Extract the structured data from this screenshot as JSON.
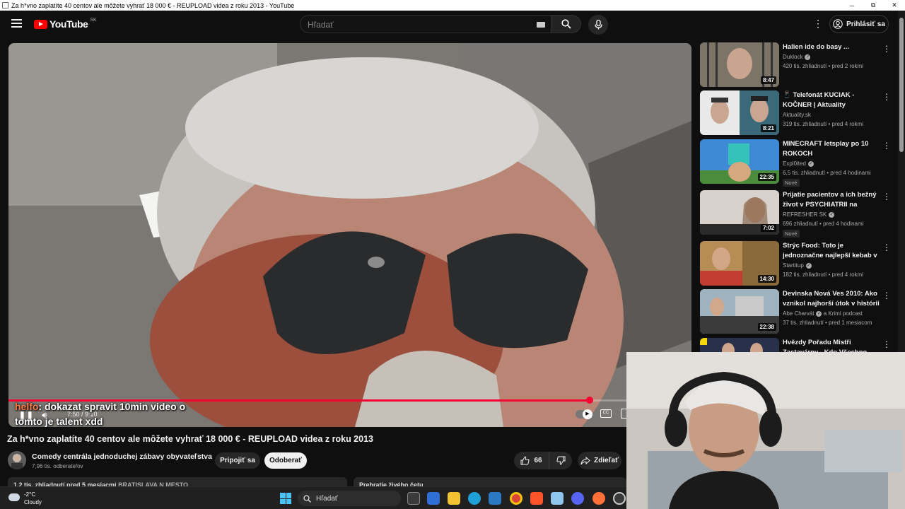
{
  "window": {
    "title": "Za h*vno zaplatíte 40 centov ale môžete vyhrať 18 000 € - REUPLOAD videa z roku 2013 - YouTube",
    "minimize": "─",
    "maximize": "⧉",
    "close": "✕"
  },
  "header": {
    "logo_text": "YouTube",
    "country_code": "SK",
    "search_placeholder": "Hľadať",
    "signin_label": "Prihlásiť sa"
  },
  "player": {
    "current_time": "7:50",
    "duration": "9:10",
    "time_display": "7:50 / 9:10",
    "progress": 0.94,
    "chat_user": "helfo",
    "chat_message": ": dokazat spravit 10min video o tomto je talent xdd"
  },
  "video": {
    "title": "Za h*vno zaplatíte 40 centov ale môžete vyhrať 18 000 € - REUPLOAD videa z roku 2013",
    "channel": "Comedy centrála jednoduchej zábavy obyvateľstva",
    "subscribers": "7,96 tis. odberateľov",
    "join_label": "Pripojiť sa",
    "subscribe_label": "Odoberať",
    "likes": "66",
    "share_label": "Zdieľať",
    "description_stats": "1,2 tis. zhliadnutí pred 5 mesiacmi",
    "description_tag": "BRATISLAVA N MESTO",
    "live_chat_label": "Prehratie živého četu"
  },
  "sidebar": {
    "items": [
      {
        "title": "Halien ide do basy ...",
        "channel": "Duklock",
        "verified": true,
        "meta": "420 tis. zhliadnutí • pred 2 rokmi",
        "duration": "8:47",
        "badge": "",
        "thumb_color": "#7d7468"
      },
      {
        "title": "📱 Telefonát  KUCIAK - KOČNER | Aktuality",
        "channel": "Aktuality.sk",
        "verified": false,
        "meta": "319 tis. zhliadnutí • pred 4 rokmi",
        "duration": "8:21",
        "badge": "",
        "thumb_color": "#e9e9e9"
      },
      {
        "title": "MINECRAFT letsplay po 10 ROKOCH",
        "channel": "Expl0ited",
        "verified": true,
        "meta": "6,5 tis. zhliadnutí • pred 4 hodinami",
        "duration": "22:35",
        "badge": "Nové",
        "thumb_color": "#3f8ad6"
      },
      {
        "title": "Prijatie pacientov a ich bežný život v PSYCHIATRII na Predn...",
        "channel": "REFRESHER SK",
        "verified": true,
        "meta": "696 zhliadnutí • pred 4 hodinami",
        "duration": "7:02",
        "badge": "Nové",
        "thumb_color": "#d9d1cb"
      },
      {
        "title": "Strýc Food: Toto je jednoznačne najlepší kebab v Bratislave 👌",
        "channel": "Startitup",
        "verified": true,
        "meta": "182 tis. zhliadnutí • pred 4 rokmi",
        "duration": "14:30",
        "badge": "",
        "thumb_color": "#b88c55"
      },
      {
        "title": "Devinska Nová Ves 2010: Ako vznikol najhorší útok v histórii ...",
        "channel": "Abe Charvát",
        "verified": true,
        "channel_suffix": "a Krimi podcast",
        "meta": "37 tis. zhliadnutí • pred 1 mesiacom",
        "duration": "22:38",
        "badge": "",
        "thumb_color": "#9fb2bf"
      },
      {
        "title": "Hvězdy Pořadu Mistři Zastavárny - Kdo Všechno...",
        "channel": "",
        "verified": false,
        "meta": "",
        "duration": "",
        "badge": "",
        "thumb_color": "#27324a"
      }
    ]
  },
  "taskbar": {
    "temperature": "-2°C",
    "weather": "Cloudy",
    "search_label": "Hľadať"
  },
  "colors": {
    "accent": "#ff0033",
    "background": "#0f0f0f",
    "chat_user": "#ff7a45"
  }
}
